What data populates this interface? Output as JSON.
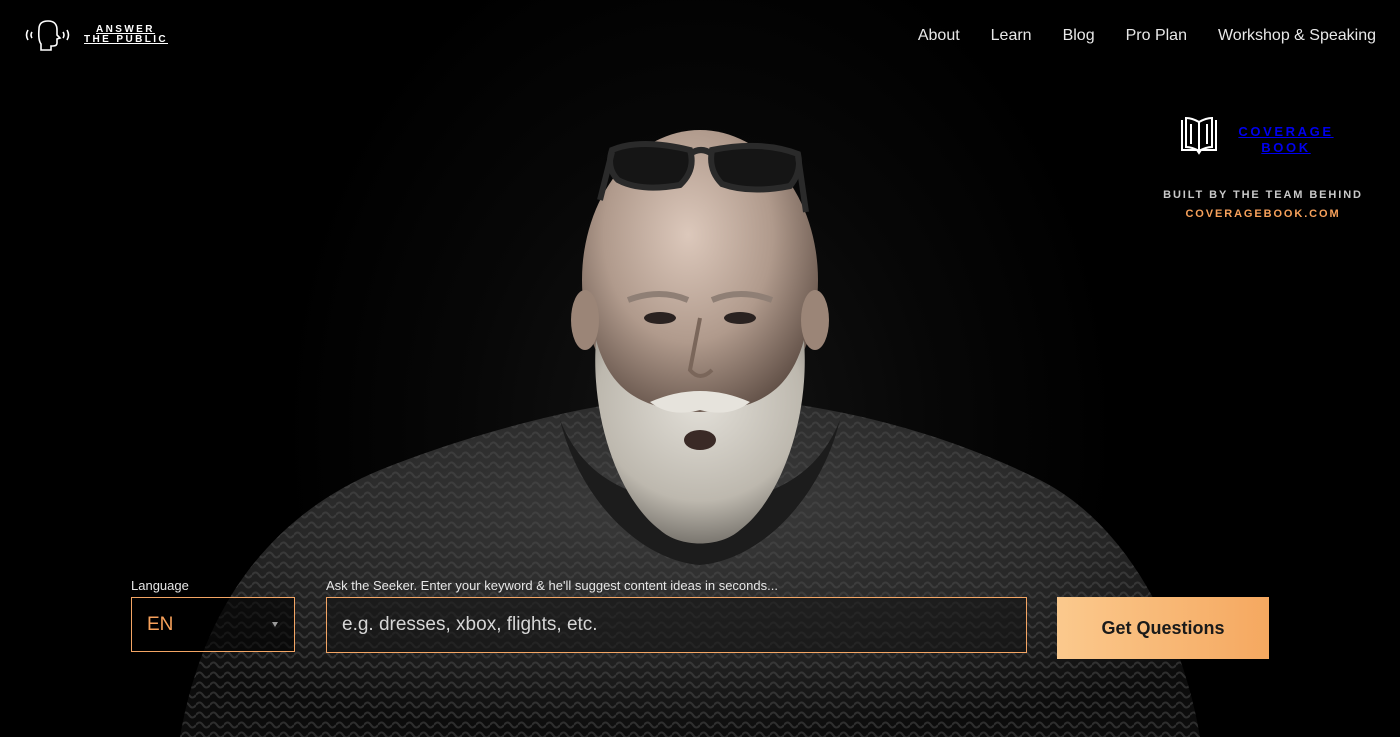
{
  "brand": {
    "line1": "ANSWER",
    "line2": "THE PUBLIC"
  },
  "nav": {
    "items": [
      {
        "label": "About"
      },
      {
        "label": "Learn"
      },
      {
        "label": "Blog"
      },
      {
        "label": "Pro Plan"
      },
      {
        "label": "Workshop & Speaking"
      }
    ]
  },
  "coverage_book": {
    "name_line1": "COVERAGE",
    "name_line2": "BOOK",
    "tagline": "BUILT BY THE TEAM BEHIND",
    "link": "COVERAGEBOOK.COM"
  },
  "search": {
    "language_label": "Language",
    "language_value": "EN",
    "keyword_label": "Ask the Seeker. Enter your keyword & he'll suggest content ideas in seconds...",
    "keyword_placeholder": "e.g. dresses, xbox, flights, etc.",
    "keyword_value": "",
    "submit_label": "Get Questions"
  },
  "colors": {
    "background": "#000000",
    "accent": "#f7a15b",
    "button_gradient_start": "#fbc98d",
    "button_gradient_end": "#f5a860"
  },
  "icons": {
    "logo": "speaking-head-icon",
    "coverage_book": "open-book-icon",
    "language_caret": "caret-down-icon"
  }
}
